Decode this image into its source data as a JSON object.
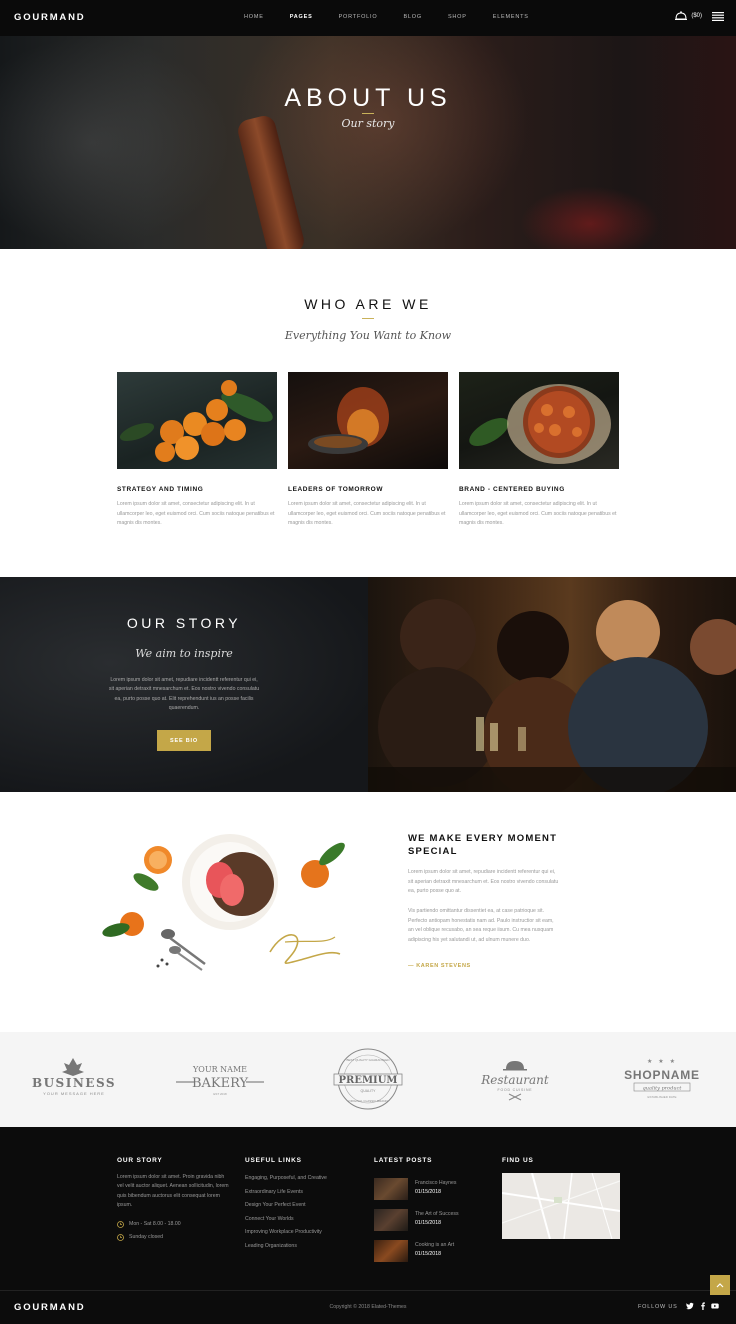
{
  "nav": {
    "logo": "GOURMAND",
    "links": [
      "HOME",
      "PAGES",
      "PORTFOLIO",
      "BLOG",
      "SHOP",
      "ELEMENTS"
    ],
    "cart_count": "($0)",
    "cart_icon": "cloche-icon",
    "menu_icon": "hamburger-menu-icon"
  },
  "hero": {
    "title": "ABOUT US",
    "subtitle": "Our story"
  },
  "who": {
    "title": "WHO ARE WE",
    "script": "Everything You Want to Know",
    "cards": [
      {
        "title": "STRATEGY AND TIMING",
        "text": "Lorem ipsum dolor sit amet, consectetur adipiscing elit. In ut ullamcorper leo, eget euismod orci. Cum sociis natoque penatibus et magnis dis montes."
      },
      {
        "title": "LEADERS OF TOMORROW",
        "text": "Lorem ipsum dolor sit amet, consectetur adipiscing elit. In ut ullamcorper leo, eget euismod orci. Cum sociis natoque penatibus et magnis dis montes."
      },
      {
        "title": "BRAND - CENTERED BUYING",
        "text": "Lorem ipsum dolor sit amet, consectetur adipiscing elit. In ut ullamcorper leo, eget euismod orci. Cum sociis natoque penatibus et magnis dis montes."
      }
    ]
  },
  "story": {
    "title": "OUR STORY",
    "script": "We aim to inspire",
    "text": "Lorem ipsum dolor sit amet, repudiare incidentt referentur qui ei, sit aperian detraxit mnesarchum et. Eos nostro vivendo consulatu ea, purto posse quo at. Elit reprehendunt ius an posse facilis quaerendum.",
    "button": "SEE BIO"
  },
  "moment": {
    "title_line1": "WE MAKE EVERY MOMENT",
    "title_line2": "SPECIAL",
    "p1": "Lorem ipsum dolor sit amet, repudiare incidentt referentur qui ei, sit aperian detraxit mnesarchum et. Eos nostro vivendo consulatu ea, purto posse quo at.",
    "p2": "Vis partiendo omittantur dissentiet ea, at case patrioque sit. Perfecto antiopam honestatis nam ad. Paulo instructior sit eam, an vel oblique recusabo, an sea reque iisum. Cu mea nusquam adipiscing his yet salutandi ut, ad ulnum munere duo.",
    "author": "— KAREN STEVENS"
  },
  "logos": {
    "business": {
      "main": "BUSINESS",
      "sub": "YOUR MESSAGE HERE"
    },
    "bakery": {
      "top": "YOUR NAME",
      "main": "BAKERY",
      "sub": "EST 2018"
    },
    "premium": {
      "main": "PREMIUM",
      "sub": "QUALITY",
      "ring_top": "BEST QUALITY GUARANTEED",
      "ring_bottom": "ORIGINAL CLASSIC BRAND"
    },
    "restaurant": {
      "main": "Restaurant",
      "sub": "FOOD CUISINE"
    },
    "shopname": {
      "main": "SHOPNAME",
      "sub": "quality product",
      "tag": "ESTABLISHED DATE"
    }
  },
  "footer": {
    "our_story": {
      "title": "OUR STORY",
      "text": "Lorem ipsum dolor sit amet. Proin gravida nibh vel velit auctor aliquet. Aenean sollicitudin, lorem quis bibendum auctorus elit consequat lorem ipsum.",
      "hours": "Mon - Sat 8.00 - 18.00",
      "closed": "Sunday closed"
    },
    "useful_links": {
      "title": "USEFUL LINKS",
      "items": [
        "Engaging, Purposeful, and Creative",
        "Extraordinary Life Events",
        "Design Your Perfect Event",
        "Connect Your Worlds",
        "Improving Workplace Productivity",
        "Leading Organizations"
      ]
    },
    "latest_posts": {
      "title": "LATEST POSTS",
      "items": [
        {
          "title": "Francisco Haynes",
          "date": "01/15/2018"
        },
        {
          "title": "The Art of Success",
          "date": "01/15/2018"
        },
        {
          "title": "Cooking is an Art",
          "date": "01/15/2018"
        }
      ]
    },
    "find_us": {
      "title": "FIND US"
    },
    "logo": "GOURMAND",
    "copyright": "Copyright © 2018 Elated-Themes",
    "follow": "FOLLOW US",
    "social": [
      "twitter-icon",
      "facebook-icon",
      "youtube-icon"
    ]
  },
  "colors": {
    "accent": "#c4a748",
    "dark": "#0c0c0c"
  }
}
